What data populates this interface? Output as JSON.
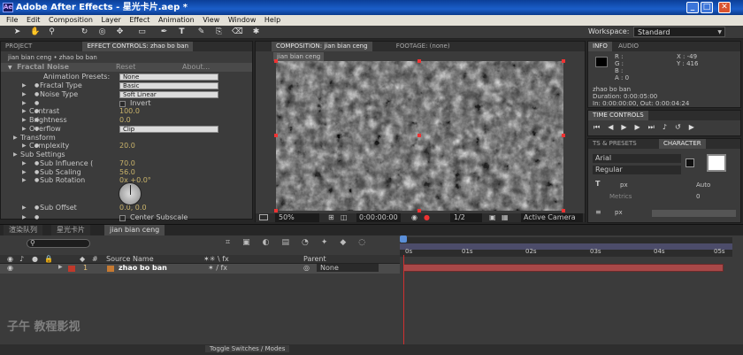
{
  "window": {
    "title": "Adobe After Effects - 星光卡片.aep *",
    "minimize": "_",
    "maximize": "□",
    "close": "✕"
  },
  "menu": [
    "File",
    "Edit",
    "Composition",
    "Layer",
    "Effect",
    "Animation",
    "View",
    "Window",
    "Help"
  ],
  "toolbar": {
    "workspace_label": "Workspace:",
    "workspace_value": "Standard",
    "tools": [
      "selection-tool",
      "hand-tool",
      "zoom-tool",
      "rotation-tool",
      "camera-tool",
      "pan-behind-tool",
      "rectangle-tool",
      "pen-tool",
      "text-tool",
      "brush-tool",
      "clone-tool",
      "eraser-tool",
      "puppet-tool"
    ]
  },
  "effect_controls": {
    "tabs": [
      "PROJECT",
      "EFFECT CONTROLS: zhao bo ban"
    ],
    "breadcrumb": "jian bian ceng • zhao bo ban",
    "effect_name": "Fractal Noise",
    "reset": "Reset",
    "about": "About...",
    "properties": [
      {
        "label": "Animation Presets:",
        "value": "None",
        "type": "dropdown"
      },
      {
        "label": "Fractal Type",
        "value": "Basic",
        "type": "dropdown"
      },
      {
        "label": "Noise Type",
        "value": "Soft Linear",
        "type": "dropdown"
      },
      {
        "label": "",
        "value": "Invert",
        "type": "checkbox"
      },
      {
        "label": "Contrast",
        "value": "100.0",
        "type": "number"
      },
      {
        "label": "Brightness",
        "value": "0.0",
        "type": "number"
      },
      {
        "label": "Overflow",
        "value": "Clip",
        "type": "dropdown"
      },
      {
        "label": "Transform",
        "value": "",
        "type": "group"
      },
      {
        "label": "Complexity",
        "value": "20.0",
        "type": "number"
      },
      {
        "label": "Sub Settings",
        "value": "",
        "type": "group"
      },
      {
        "label": "Sub Influence (",
        "value": "70.0",
        "type": "number"
      },
      {
        "label": "Sub Scaling",
        "value": "56.0",
        "type": "number"
      },
      {
        "label": "Sub Rotation",
        "value": "0x +0.0°",
        "type": "number"
      },
      {
        "label": "Sub Offset",
        "value": "0.0, 0.0",
        "type": "number"
      },
      {
        "label": "",
        "value": "Center Subscale",
        "type": "checkbox"
      }
    ]
  },
  "composition": {
    "tabs": [
      "COMPOSITION: jian bian ceng",
      "FOOTAGE: (none)"
    ],
    "sub_tab": "jian bian ceng",
    "zoom": "50%",
    "timecode": "0:00:00:00",
    "resolution": "1/2",
    "camera": "Active Camera"
  },
  "info": {
    "tabs": [
      "INFO",
      "AUDIO"
    ],
    "r": "R :",
    "g": "G :",
    "b": "B :",
    "a": "A : 0",
    "x": "X : -49",
    "y": "Y : 416",
    "layer": "zhao bo ban",
    "duration": "Duration: 0:00:05:00",
    "inout": "In: 0:00:00:00, Out: 0:00:04:24"
  },
  "time_controls": {
    "tab": "TIME CONTROLS"
  },
  "character": {
    "tabs": [
      "TS & PRESETS",
      "CHARACTER"
    ],
    "font": "Arial",
    "style": "Regular",
    "size_unit": "px",
    "leading": "Auto",
    "tracking_label": "Metrics",
    "kerning": "0",
    "stroke_unit": "px"
  },
  "timeline": {
    "tabs": [
      "渲染队列",
      "星光卡片",
      "jian bian ceng"
    ],
    "search_placeholder": "",
    "columns": {
      "source_name": "Source Name",
      "parent": "Parent"
    },
    "layers": [
      {
        "num": "1",
        "name": "zhao bo ban",
        "parent": "None",
        "label_color": "#c0392b"
      }
    ],
    "ruler": [
      "0s",
      "01s",
      "02s",
      "03s",
      "04s",
      "05s"
    ],
    "toggle": "Toggle Switches / Modes",
    "watermark": "子午 教程影视"
  },
  "colors": {
    "accent": "#f0a030",
    "track": "#a84848",
    "playhead": "#d03030"
  }
}
